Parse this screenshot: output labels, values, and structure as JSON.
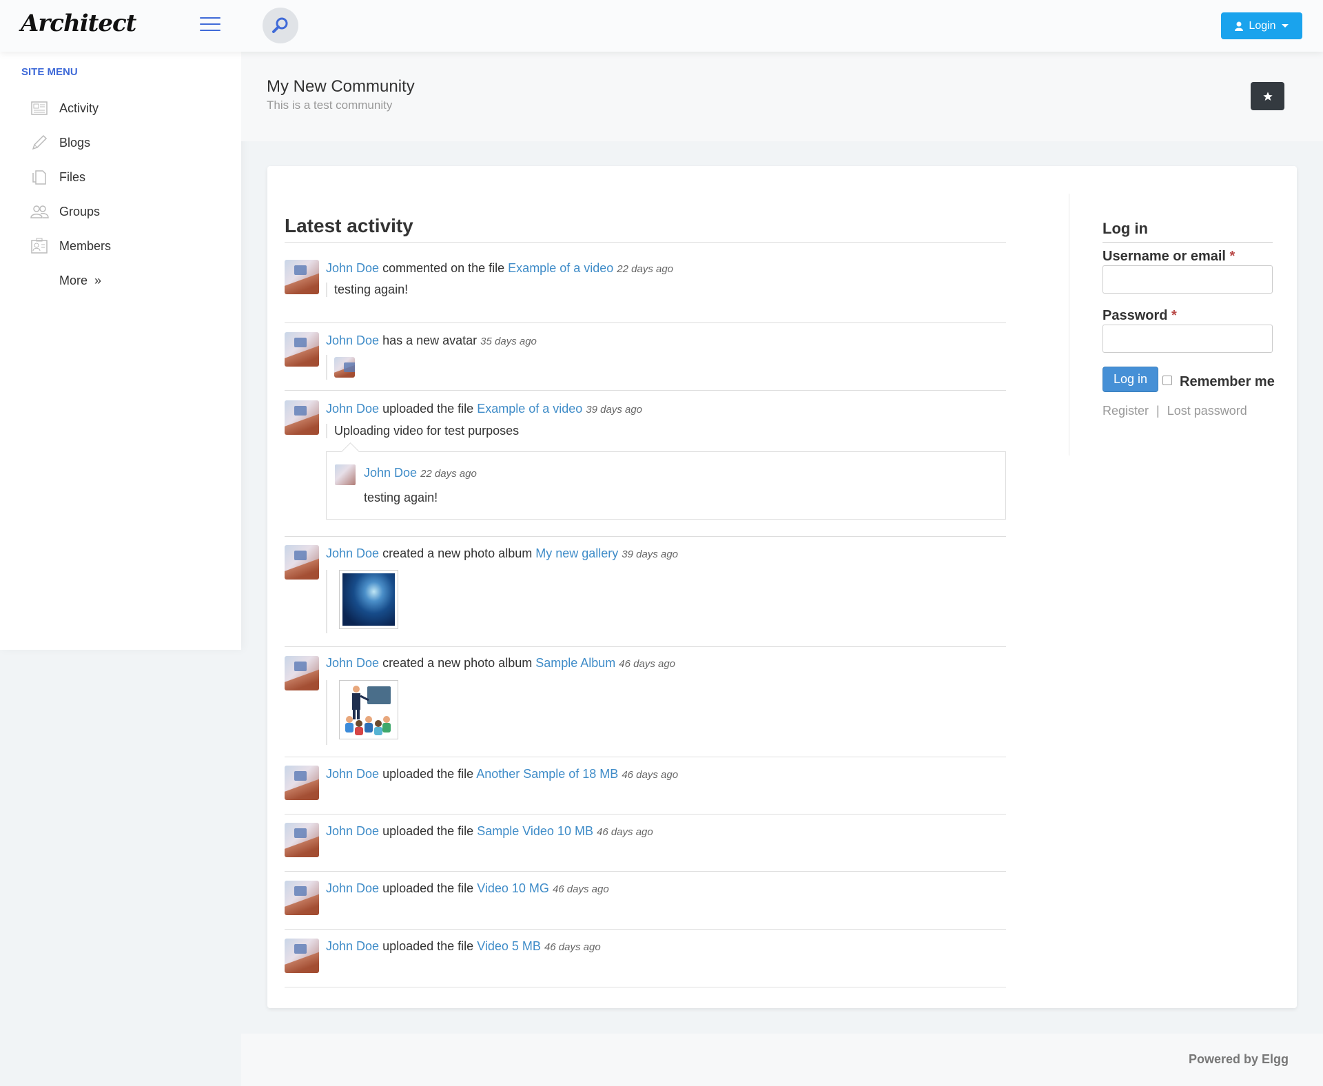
{
  "header": {
    "logo_text": "Architect",
    "login_label": "Login"
  },
  "sidebar": {
    "title": "SITE MENU",
    "items": [
      {
        "label": "Activity",
        "icon": "activity-icon"
      },
      {
        "label": "Blogs",
        "icon": "pencil-icon"
      },
      {
        "label": "Files",
        "icon": "files-icon"
      },
      {
        "label": "Groups",
        "icon": "groups-icon"
      },
      {
        "label": "Members",
        "icon": "members-icon"
      },
      {
        "label": "More  »",
        "icon": ""
      }
    ]
  },
  "page": {
    "title": "My New Community",
    "subtitle": "This is a test community"
  },
  "activity": {
    "title": "Latest activity",
    "items": [
      {
        "user": "John Doe",
        "action": " commented on the file ",
        "target": "Example of a video",
        "time": "22 days ago",
        "message": "testing again!"
      },
      {
        "user": "John Doe",
        "action": " has a new avatar",
        "target": "",
        "time": "35 days ago"
      },
      {
        "user": "John Doe",
        "action": " uploaded the file ",
        "target": "Example of a video",
        "time": "39 days ago",
        "message": "Uploading video for test purposes",
        "comment": {
          "user": "John Doe",
          "time": "22 days ago",
          "text": "testing again!"
        }
      },
      {
        "user": "John Doe",
        "action": " created a new photo album ",
        "target": "My new gallery",
        "time": "39 days ago"
      },
      {
        "user": "John Doe",
        "action": " created a new photo album ",
        "target": "Sample Album",
        "time": "46 days ago"
      },
      {
        "user": "John Doe",
        "action": " uploaded the file ",
        "target": "Another Sample of 18 MB",
        "time": "46 days ago"
      },
      {
        "user": "John Doe",
        "action": " uploaded the file ",
        "target": "Sample Video 10 MB",
        "time": "46 days ago"
      },
      {
        "user": "John Doe",
        "action": " uploaded the file ",
        "target": "Video 10 MG",
        "time": "46 days ago"
      },
      {
        "user": "John Doe",
        "action": " uploaded the file ",
        "target": "Video 5 MB",
        "time": "46 days ago"
      }
    ]
  },
  "login": {
    "title": "Log in",
    "username_label": "Username or email",
    "password_label": "Password",
    "required_mark": "*",
    "button": "Log in",
    "remember": "Remember me",
    "register": "Register",
    "separator": "|",
    "lost_password": "Lost password"
  },
  "footer": {
    "powered": "Powered by Elgg"
  },
  "colors": {
    "accent": "#3f6ad8",
    "link": "#3f8cc8",
    "login_button": "#1aa3ed",
    "dark_button": "#343a40"
  }
}
